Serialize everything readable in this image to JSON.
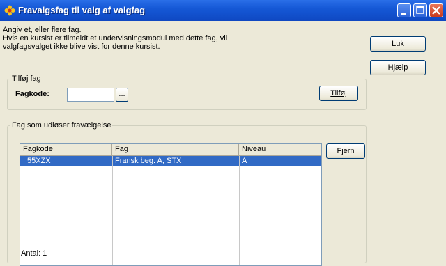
{
  "window": {
    "title": "Fravalgsfag til valg af valgfag",
    "app_icon": "flower-icon",
    "controls": [
      "minimize-icon",
      "maximize-icon",
      "close-icon"
    ]
  },
  "intro": {
    "line1": "Angiv et, eller flere fag.",
    "line2": "Hvis en kursist er tilmeldt et undervisningsmodul med dette fag, vil",
    "line3": "valgfagsvalget ikke blive vist for denne kursist."
  },
  "buttons": {
    "luk": "Luk",
    "hjaelp": "Hjælp",
    "tilfoj": "Tilføj",
    "fjern": "Fjern",
    "lookup": "..."
  },
  "add_group": {
    "legend": "Tilføj fag",
    "fagkode_label": "Fagkode:",
    "fagkode_value": ""
  },
  "list_group": {
    "legend": "Fag som udløser fravælgelse",
    "columns": [
      "Fagkode",
      "Fag",
      "Niveau"
    ],
    "rows": [
      {
        "fagkode": "55XZX",
        "fag": "Fransk beg. A, STX",
        "niveau": "A"
      }
    ],
    "count_label": "Antal: 1"
  },
  "colors": {
    "titlebar": "#1558d6",
    "selection": "#316ac5",
    "face": "#ece9d8"
  }
}
